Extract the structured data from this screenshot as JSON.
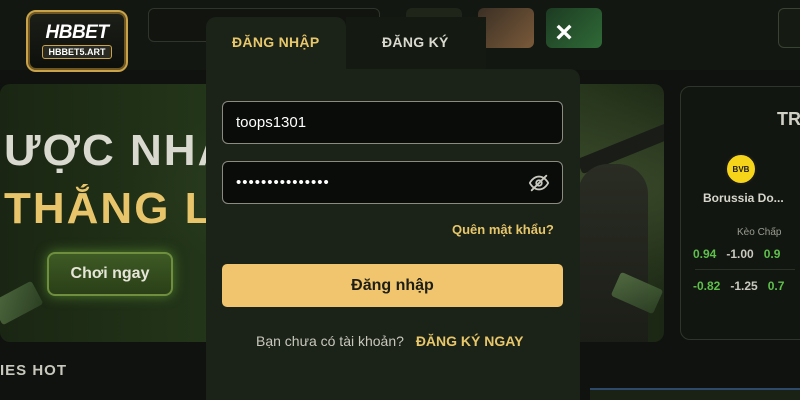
{
  "logo": {
    "main": "HBBET",
    "sub": "HBBET5.ART"
  },
  "banner": {
    "line1": "ƯỢC NHAN",
    "line2": "THẮNG LỚ",
    "play_button": "Chơi ngay"
  },
  "section": {
    "title": "IES HOT"
  },
  "match_card": {
    "title": "TR",
    "team": "Borussia Do...",
    "crest_text": "BVB",
    "odds_label": "Kèo Chấp",
    "odds_rows": [
      [
        "0.94",
        "-1.00",
        "0.9"
      ],
      [
        "-0.82",
        "-1.25",
        "0.7"
      ]
    ]
  },
  "modal": {
    "tabs": {
      "login": "ĐĂNG NHẬP",
      "register": "ĐĂNG KÝ"
    },
    "close_icon": "×",
    "username_value": "toops1301",
    "password_masked": "•••••••••••••••",
    "forgot": "Quên mật khẩu?",
    "login_button": "Đăng nhập",
    "no_account": "Bạn chưa có tài khoản?",
    "register_now": "ĐĂNG KÝ NGAY",
    "accent_color": "#f0c56d"
  }
}
